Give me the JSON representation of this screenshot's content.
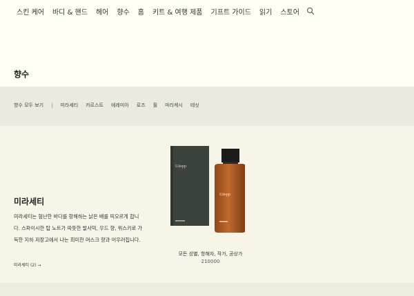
{
  "nav": {
    "items": [
      "스킨 케어",
      "바디 & 핸드",
      "헤어",
      "향수",
      "홈",
      "키트 & 여행 제품",
      "기프트 가이드",
      "읽기",
      "스토어"
    ],
    "search_icon": "search-icon"
  },
  "page": {
    "title": "향수"
  },
  "subnav": {
    "all": "향수 모두 보기",
    "separator": "|",
    "items": [
      "미라세티",
      "카르스트",
      "에레미아",
      "로즈",
      "휠",
      "마라케시",
      "테싯"
    ]
  },
  "product": {
    "heading": "미라세티",
    "description": "미라세티는 험난한 바다를 항해하는 낡은 배를 띄오르게 합니다. 스파이시한 탑 노트가 따뜻한 발사믹, 우드 향, 위스키로 가득한 지하 저장고에서 나는 희미한 머스크 향과 어우러집니다.",
    "link": "미라세티 (2) →",
    "name": "모든 성별, 항해자, 작가, 공상가",
    "price": "210000",
    "box_brand": "Uāopp",
    "bottle_brand": "Uāopp",
    "colors": {
      "box": "#3c423c",
      "bottle": "#b35f25",
      "cap": "#1c1c1c"
    }
  }
}
